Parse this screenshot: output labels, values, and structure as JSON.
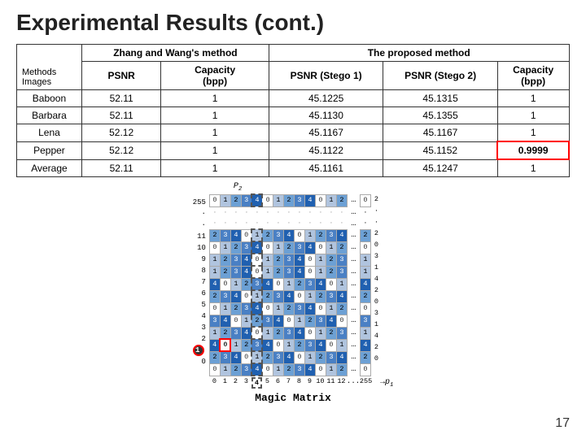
{
  "title": "Experimental Results (cont.)",
  "table": {
    "col_headers_row1": {
      "methods_images": "Methods\nImages",
      "zhang_wang": "Zhang and Wang's method",
      "proposed": "The proposed method"
    },
    "col_headers_row2": {
      "psnr": "PSNR",
      "capacity_bpp": "Capacity\n(bpp)",
      "psnr_stego1": "PSNR (Stego 1)",
      "psnr_stego2": "PSNR (Stego 2)",
      "capacity_bpp2": "Capacity\n(bpp)"
    },
    "rows": [
      {
        "image": "Baboon",
        "psnr": "52.11",
        "cap1": "1",
        "ps1": "45.1225",
        "ps2": "45.1315",
        "cap2": "1"
      },
      {
        "image": "Barbara",
        "psnr": "52.11",
        "cap1": "1",
        "ps1": "45.1130",
        "ps2": "45.1355",
        "cap2": "1"
      },
      {
        "image": "Lena",
        "psnr": "52.12",
        "cap1": "1",
        "ps1": "45.1167",
        "ps2": "45.1167",
        "cap2": "1"
      },
      {
        "image": "Pepper",
        "psnr": "52.12",
        "cap1": "1",
        "ps1": "45.1122",
        "ps2": "45.1152",
        "cap2": "0.9999",
        "highlight": true
      },
      {
        "image": "Average",
        "psnr": "52.11",
        "cap1": "1",
        "ps1": "45.1161",
        "ps2": "45.1247",
        "cap2": "1"
      }
    ]
  },
  "matrix": {
    "title": "Magic Matrix",
    "p2_label": "P",
    "p2_subscript": "2",
    "p1_label": "p",
    "p1_subscript": "1",
    "top_row_label": "255",
    "y_labels": [
      "11",
      "10",
      "9",
      "8",
      "7",
      "6",
      "5",
      "4",
      "3",
      "2",
      "1",
      "0"
    ],
    "x_labels": [
      "0",
      "1",
      "2",
      "3",
      "4",
      "5",
      "6",
      "7",
      "8",
      "9",
      "10",
      "11",
      "12",
      "...",
      "255"
    ]
  },
  "page_number": "17"
}
